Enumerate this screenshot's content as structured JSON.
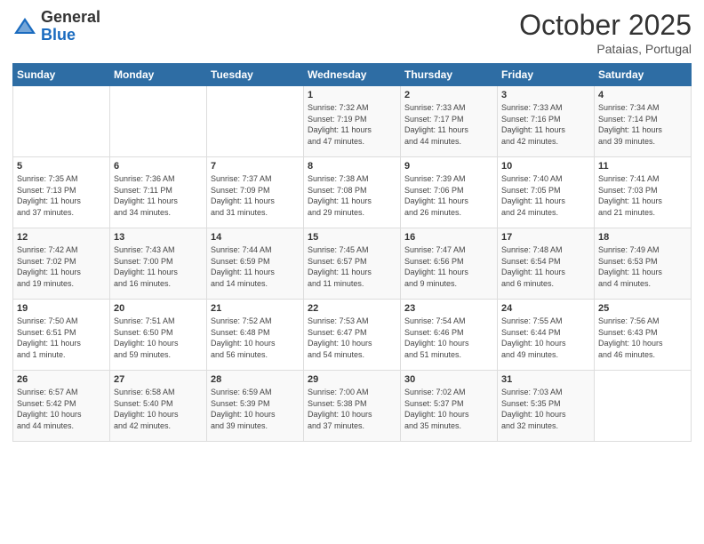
{
  "logo": {
    "general": "General",
    "blue": "Blue"
  },
  "title": {
    "month": "October 2025",
    "location": "Pataias, Portugal"
  },
  "weekdays": [
    "Sunday",
    "Monday",
    "Tuesday",
    "Wednesday",
    "Thursday",
    "Friday",
    "Saturday"
  ],
  "weeks": [
    [
      {
        "day": "",
        "info": ""
      },
      {
        "day": "",
        "info": ""
      },
      {
        "day": "",
        "info": ""
      },
      {
        "day": "1",
        "info": "Sunrise: 7:32 AM\nSunset: 7:19 PM\nDaylight: 11 hours\nand 47 minutes."
      },
      {
        "day": "2",
        "info": "Sunrise: 7:33 AM\nSunset: 7:17 PM\nDaylight: 11 hours\nand 44 minutes."
      },
      {
        "day": "3",
        "info": "Sunrise: 7:33 AM\nSunset: 7:16 PM\nDaylight: 11 hours\nand 42 minutes."
      },
      {
        "day": "4",
        "info": "Sunrise: 7:34 AM\nSunset: 7:14 PM\nDaylight: 11 hours\nand 39 minutes."
      }
    ],
    [
      {
        "day": "5",
        "info": "Sunrise: 7:35 AM\nSunset: 7:13 PM\nDaylight: 11 hours\nand 37 minutes."
      },
      {
        "day": "6",
        "info": "Sunrise: 7:36 AM\nSunset: 7:11 PM\nDaylight: 11 hours\nand 34 minutes."
      },
      {
        "day": "7",
        "info": "Sunrise: 7:37 AM\nSunset: 7:09 PM\nDaylight: 11 hours\nand 31 minutes."
      },
      {
        "day": "8",
        "info": "Sunrise: 7:38 AM\nSunset: 7:08 PM\nDaylight: 11 hours\nand 29 minutes."
      },
      {
        "day": "9",
        "info": "Sunrise: 7:39 AM\nSunset: 7:06 PM\nDaylight: 11 hours\nand 26 minutes."
      },
      {
        "day": "10",
        "info": "Sunrise: 7:40 AM\nSunset: 7:05 PM\nDaylight: 11 hours\nand 24 minutes."
      },
      {
        "day": "11",
        "info": "Sunrise: 7:41 AM\nSunset: 7:03 PM\nDaylight: 11 hours\nand 21 minutes."
      }
    ],
    [
      {
        "day": "12",
        "info": "Sunrise: 7:42 AM\nSunset: 7:02 PM\nDaylight: 11 hours\nand 19 minutes."
      },
      {
        "day": "13",
        "info": "Sunrise: 7:43 AM\nSunset: 7:00 PM\nDaylight: 11 hours\nand 16 minutes."
      },
      {
        "day": "14",
        "info": "Sunrise: 7:44 AM\nSunset: 6:59 PM\nDaylight: 11 hours\nand 14 minutes."
      },
      {
        "day": "15",
        "info": "Sunrise: 7:45 AM\nSunset: 6:57 PM\nDaylight: 11 hours\nand 11 minutes."
      },
      {
        "day": "16",
        "info": "Sunrise: 7:47 AM\nSunset: 6:56 PM\nDaylight: 11 hours\nand 9 minutes."
      },
      {
        "day": "17",
        "info": "Sunrise: 7:48 AM\nSunset: 6:54 PM\nDaylight: 11 hours\nand 6 minutes."
      },
      {
        "day": "18",
        "info": "Sunrise: 7:49 AM\nSunset: 6:53 PM\nDaylight: 11 hours\nand 4 minutes."
      }
    ],
    [
      {
        "day": "19",
        "info": "Sunrise: 7:50 AM\nSunset: 6:51 PM\nDaylight: 11 hours\nand 1 minute."
      },
      {
        "day": "20",
        "info": "Sunrise: 7:51 AM\nSunset: 6:50 PM\nDaylight: 10 hours\nand 59 minutes."
      },
      {
        "day": "21",
        "info": "Sunrise: 7:52 AM\nSunset: 6:48 PM\nDaylight: 10 hours\nand 56 minutes."
      },
      {
        "day": "22",
        "info": "Sunrise: 7:53 AM\nSunset: 6:47 PM\nDaylight: 10 hours\nand 54 minutes."
      },
      {
        "day": "23",
        "info": "Sunrise: 7:54 AM\nSunset: 6:46 PM\nDaylight: 10 hours\nand 51 minutes."
      },
      {
        "day": "24",
        "info": "Sunrise: 7:55 AM\nSunset: 6:44 PM\nDaylight: 10 hours\nand 49 minutes."
      },
      {
        "day": "25",
        "info": "Sunrise: 7:56 AM\nSunset: 6:43 PM\nDaylight: 10 hours\nand 46 minutes."
      }
    ],
    [
      {
        "day": "26",
        "info": "Sunrise: 6:57 AM\nSunset: 5:42 PM\nDaylight: 10 hours\nand 44 minutes."
      },
      {
        "day": "27",
        "info": "Sunrise: 6:58 AM\nSunset: 5:40 PM\nDaylight: 10 hours\nand 42 minutes."
      },
      {
        "day": "28",
        "info": "Sunrise: 6:59 AM\nSunset: 5:39 PM\nDaylight: 10 hours\nand 39 minutes."
      },
      {
        "day": "29",
        "info": "Sunrise: 7:00 AM\nSunset: 5:38 PM\nDaylight: 10 hours\nand 37 minutes."
      },
      {
        "day": "30",
        "info": "Sunrise: 7:02 AM\nSunset: 5:37 PM\nDaylight: 10 hours\nand 35 minutes."
      },
      {
        "day": "31",
        "info": "Sunrise: 7:03 AM\nSunset: 5:35 PM\nDaylight: 10 hours\nand 32 minutes."
      },
      {
        "day": "",
        "info": ""
      }
    ]
  ]
}
